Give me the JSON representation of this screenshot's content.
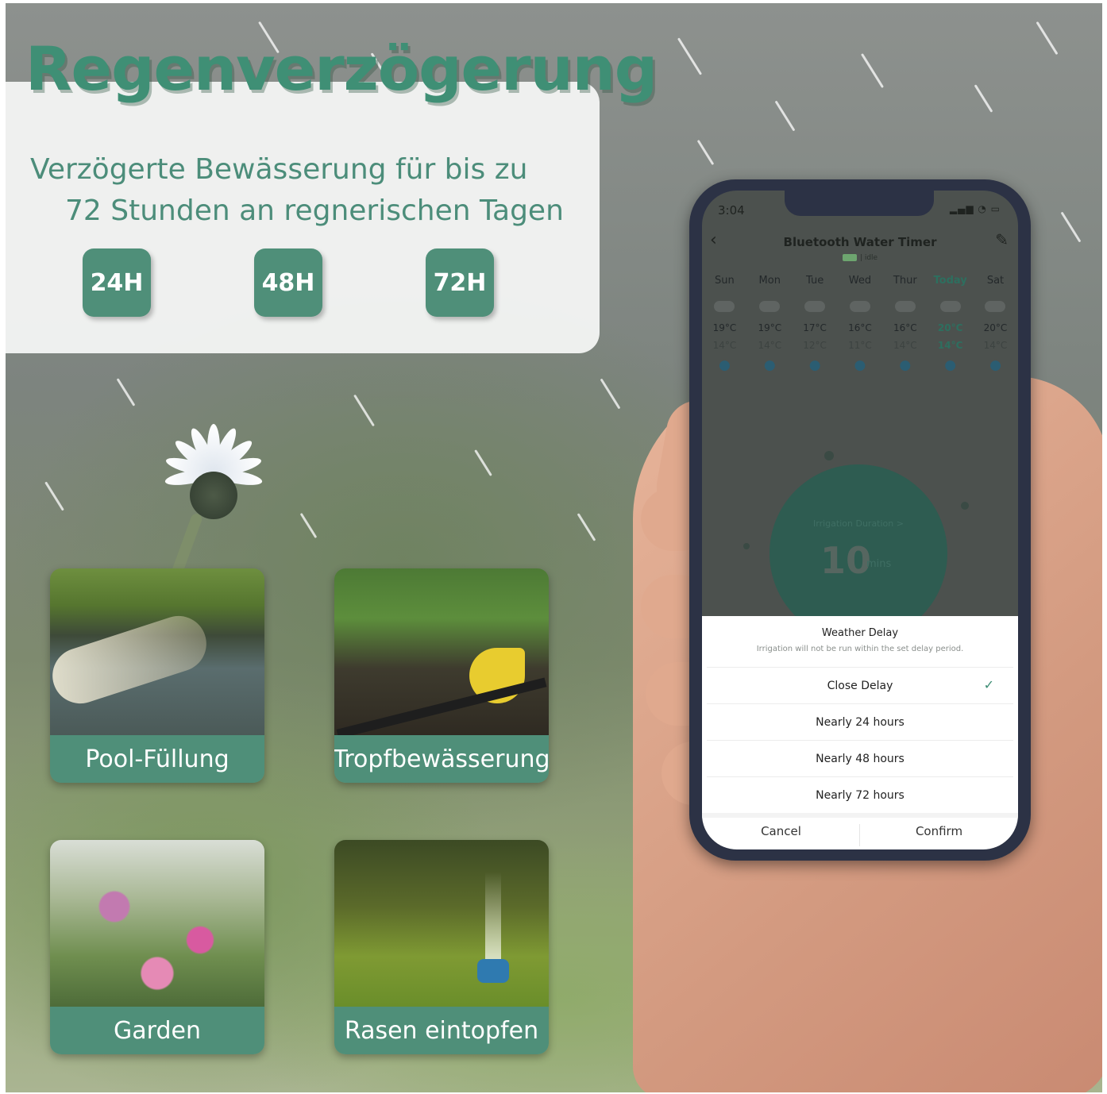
{
  "headline": "Regenverzögerung",
  "subtitle": {
    "line1": "Verzögerte Bewässerung für bis zu",
    "line2": "72 Stunden an regnerischen Tagen"
  },
  "delay_options": [
    "24H",
    "48H",
    "72H"
  ],
  "tiles": [
    {
      "label": "Pool-Füllung"
    },
    {
      "label": "Tropfbewässerung"
    },
    {
      "label": "Garden"
    },
    {
      "label": "Rasen eintopfen"
    }
  ],
  "phone": {
    "status_time": "3:04",
    "app_title": "Bluetooth Water Timer",
    "app_status": "idle",
    "weather": [
      {
        "day": "Sun",
        "high": "19°C",
        "low": "14°C"
      },
      {
        "day": "Mon",
        "high": "19°C",
        "low": "14°C"
      },
      {
        "day": "Tue",
        "high": "17°C",
        "low": "12°C"
      },
      {
        "day": "Wed",
        "high": "16°C",
        "low": "11°C"
      },
      {
        "day": "Thur",
        "high": "16°C",
        "low": "14°C"
      },
      {
        "day": "Today",
        "high": "20°C",
        "low": "14°C"
      },
      {
        "day": "Sat",
        "high": "20°C",
        "low": "14°C"
      }
    ],
    "dial": {
      "caption": "Irrigation Duration >",
      "value": "10",
      "unit": "mins"
    },
    "sheet": {
      "title": "Weather Delay",
      "description": "Irrigation will not be run within the set delay period.",
      "options": [
        "Close Delay",
        "Nearly 24 hours",
        "Nearly 48 hours",
        "Nearly 72 hours"
      ],
      "selected_option": "Close Delay",
      "cancel": "Cancel",
      "confirm": "Confirm"
    }
  },
  "colors": {
    "accent": "#4f8f79",
    "headline": "#3f8f75",
    "today": "#2d6f5f"
  },
  "icons": {
    "back": "chevron-left-icon",
    "edit": "pencil-icon",
    "weather": "cloud-icon",
    "rain": "water-drop-icon",
    "selected": "checkmark-icon"
  }
}
